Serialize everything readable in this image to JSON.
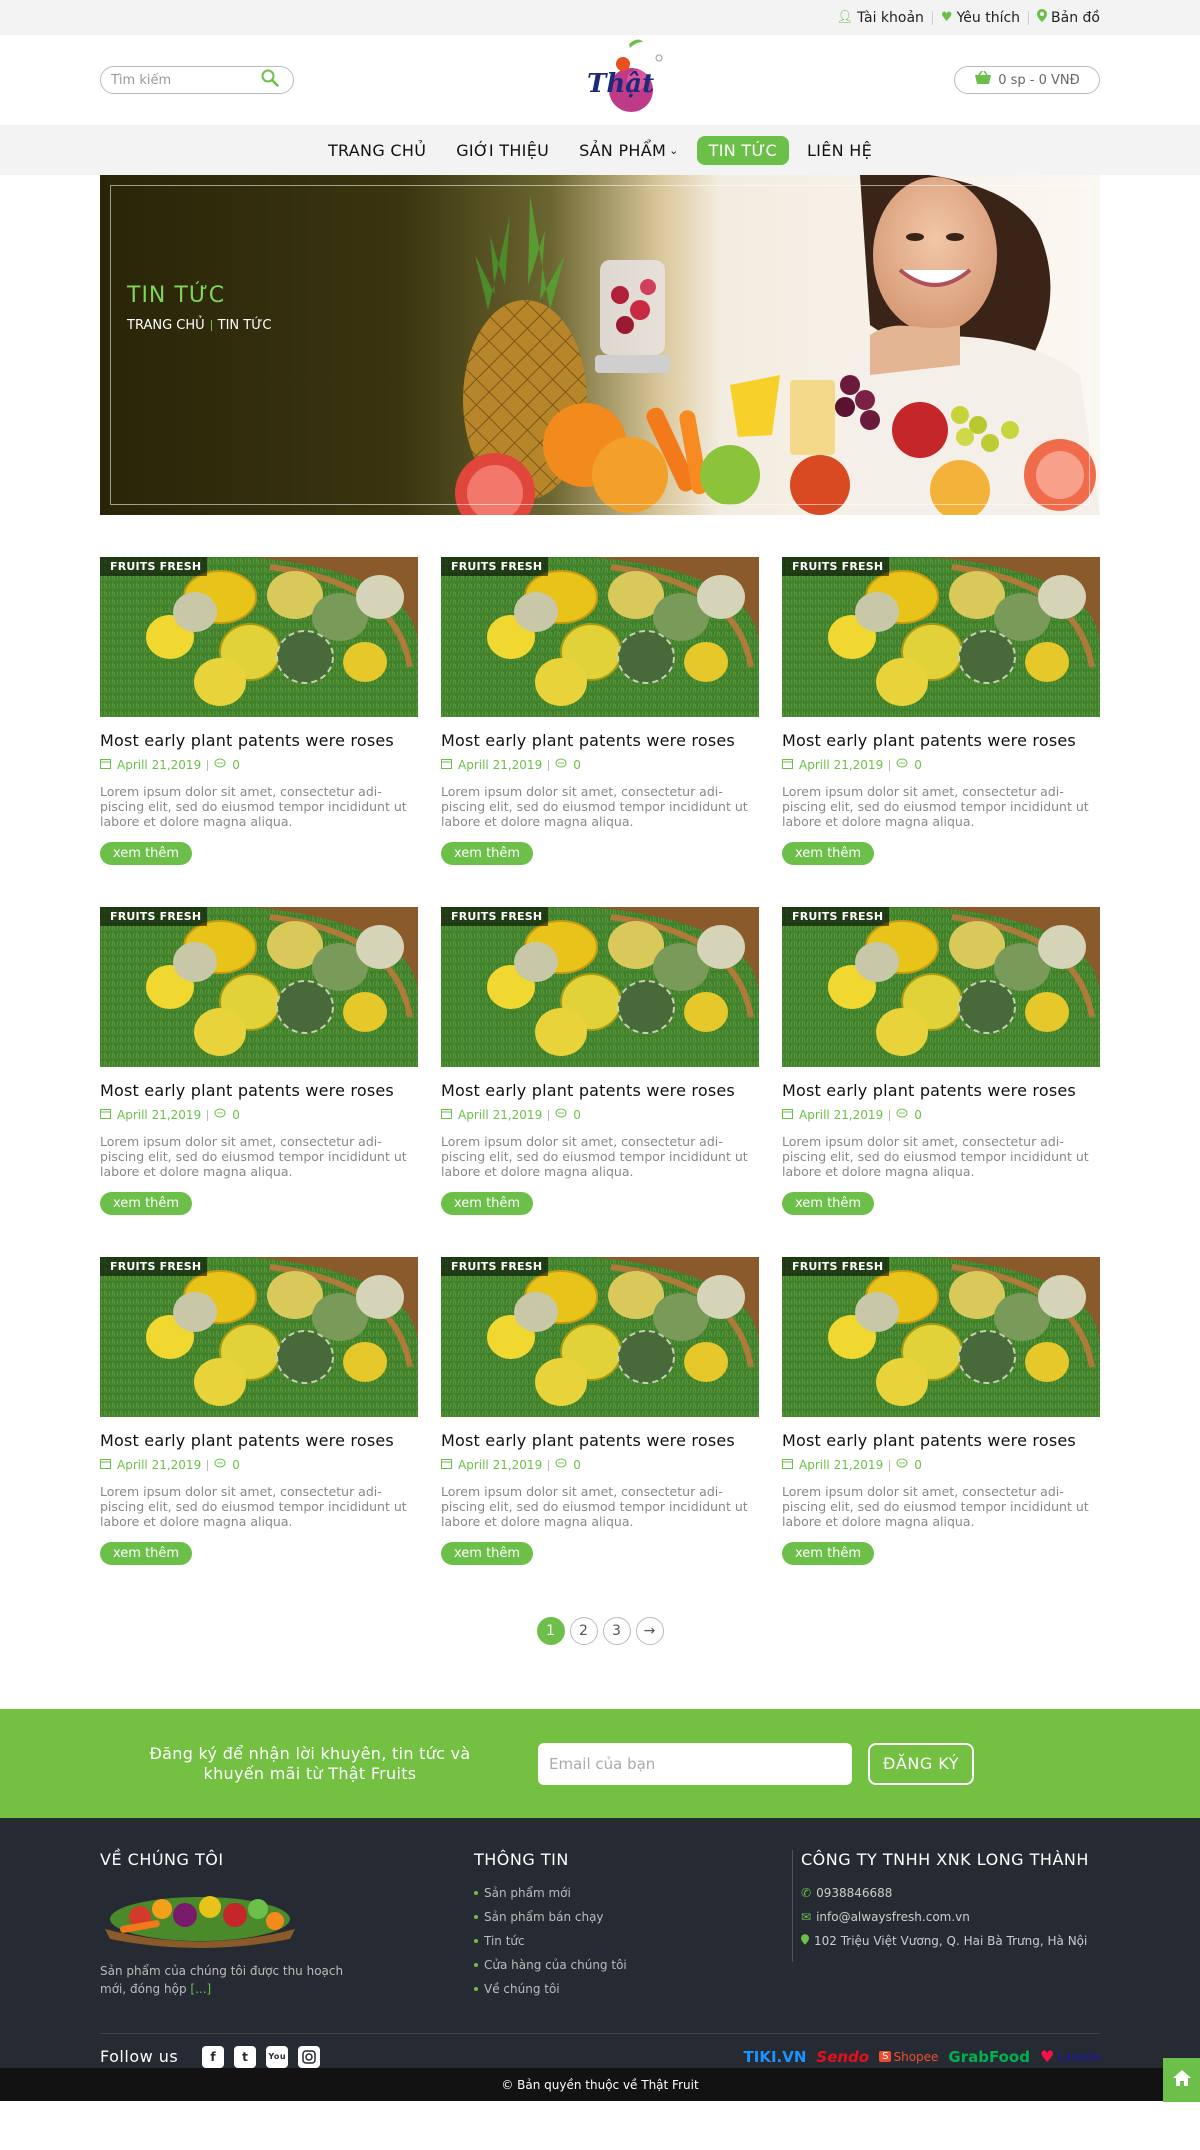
{
  "topbar": {
    "account": "Tài khoản",
    "wishlist": "Yêu thích",
    "map": "Bản đồ"
  },
  "header": {
    "search_placeholder": "Tìm kiếm",
    "logo_text": "Thật",
    "cart_label": "0 sp - 0 VNĐ"
  },
  "nav": {
    "items": [
      {
        "label": "TRANG CHỦ"
      },
      {
        "label": "GIỚI THIỆU"
      },
      {
        "label": "SẢN PHẨM"
      },
      {
        "label": "TIN TỨC"
      },
      {
        "label": "LIÊN HỆ"
      }
    ],
    "active_index": 3
  },
  "banner": {
    "title": "TIN TỨC",
    "breadcrumb": [
      "TRANG CHỦ",
      "TIN TỨC"
    ]
  },
  "posts": [
    {
      "tag": "FRUITS FRESH",
      "title": "Most early plant patents were roses",
      "date": "Aprill 21,2019",
      "comments": "0",
      "excerpt": "Lorem ipsum dolor sit amet, consectetur adi-piscing elit, sed do eiusmod tempor incididunt ut labore et dolore magna aliqua.",
      "more": "xem thêm"
    },
    {
      "tag": "FRUITS FRESH",
      "title": "Most early plant patents were roses",
      "date": "Aprill 21,2019",
      "comments": "0",
      "excerpt": "Lorem ipsum dolor sit amet, consectetur adi-piscing elit, sed do eiusmod tempor incididunt ut labore et dolore magna aliqua.",
      "more": "xem thêm"
    },
    {
      "tag": "FRUITS FRESH",
      "title": "Most early plant patents were roses",
      "date": "Aprill 21,2019",
      "comments": "0",
      "excerpt": "Lorem ipsum dolor sit amet, consectetur adi-piscing elit, sed do eiusmod tempor incididunt ut labore et dolore magna aliqua.",
      "more": "xem thêm"
    },
    {
      "tag": "FRUITS FRESH",
      "title": "Most early plant patents were roses",
      "date": "Aprill 21,2019",
      "comments": "0",
      "excerpt": "Lorem ipsum dolor sit amet, consectetur adi-piscing elit, sed do eiusmod tempor incididunt ut labore et dolore magna aliqua.",
      "more": "xem thêm"
    },
    {
      "tag": "FRUITS FRESH",
      "title": "Most early plant patents were roses",
      "date": "Aprill 21,2019",
      "comments": "0",
      "excerpt": "Lorem ipsum dolor sit amet, consectetur adi-piscing elit, sed do eiusmod tempor incididunt ut labore et dolore magna aliqua.",
      "more": "xem thêm"
    },
    {
      "tag": "FRUITS FRESH",
      "title": "Most early plant patents were roses",
      "date": "Aprill 21,2019",
      "comments": "0",
      "excerpt": "Lorem ipsum dolor sit amet, consectetur adi-piscing elit, sed do eiusmod tempor incididunt ut labore et dolore magna aliqua.",
      "more": "xem thêm"
    },
    {
      "tag": "FRUITS FRESH",
      "title": "Most early plant patents were roses",
      "date": "Aprill 21,2019",
      "comments": "0",
      "excerpt": "Lorem ipsum dolor sit amet, consectetur adi-piscing elit, sed do eiusmod tempor incididunt ut labore et dolore magna aliqua.",
      "more": "xem thêm"
    },
    {
      "tag": "FRUITS FRESH",
      "title": "Most early plant patents were roses",
      "date": "Aprill 21,2019",
      "comments": "0",
      "excerpt": "Lorem ipsum dolor sit amet, consectetur adi-piscing elit, sed do eiusmod tempor incididunt ut labore et dolore magna aliqua.",
      "more": "xem thêm"
    },
    {
      "tag": "FRUITS FRESH",
      "title": "Most early plant patents were roses",
      "date": "Aprill 21,2019",
      "comments": "0",
      "excerpt": "Lorem ipsum dolor sit amet, consectetur adi-piscing elit, sed do eiusmod tempor incididunt ut labore et dolore magna aliqua.",
      "more": "xem thêm"
    }
  ],
  "pagination": {
    "pages": [
      "1",
      "2",
      "3"
    ],
    "current": "1",
    "next": "→"
  },
  "newsletter": {
    "text": "Đăng ký để nhận lời khuyên, tin tức và khuyến mãi từ Thật Fruits",
    "placeholder": "Email của bạn",
    "button": "ĐĂNG KÝ"
  },
  "footer": {
    "about": {
      "heading": "VỀ CHÚNG TÔI",
      "text": "Sản phẩm của chúng tôi được thu hoạch mới, đóng hộp",
      "link": "[...]"
    },
    "info": {
      "heading": "THÔNG TIN",
      "links": [
        "Sản phẩm mới",
        "Sản phẩm bán chạy",
        "Tin tức",
        "Cửa hàng của chúng tôi",
        "Về chúng tôi"
      ]
    },
    "company": {
      "heading": "CÔNG TY TNHH XNK LONG THÀNH",
      "phone": "0938846688",
      "email": "info@alwaysfresh.com.vn",
      "address": "102 Triệu Việt Vương, Q. Hai Bà Trưng, Hà Nội"
    },
    "follow_label": "Follow us",
    "social_icons": [
      "facebook-icon",
      "twitter-icon",
      "youtube-icon",
      "instagram-icon"
    ],
    "partners": [
      {
        "name": "TIKI.VN",
        "color": "#1a94ff"
      },
      {
        "name": "Sendo",
        "color": "#e5101d"
      },
      {
        "name": "Shopee",
        "color": "#ee4d2d"
      },
      {
        "name": "GrabFood",
        "color": "#00b14f"
      },
      {
        "name": "Lazada",
        "color": "#1a1aa6"
      }
    ],
    "copyright": "© Bản quyền thuộc về Thật Fruit"
  },
  "colors": {
    "accent": "#6cc04a",
    "footer_bg": "#262a33",
    "newsletter_bg": "#74c043"
  }
}
